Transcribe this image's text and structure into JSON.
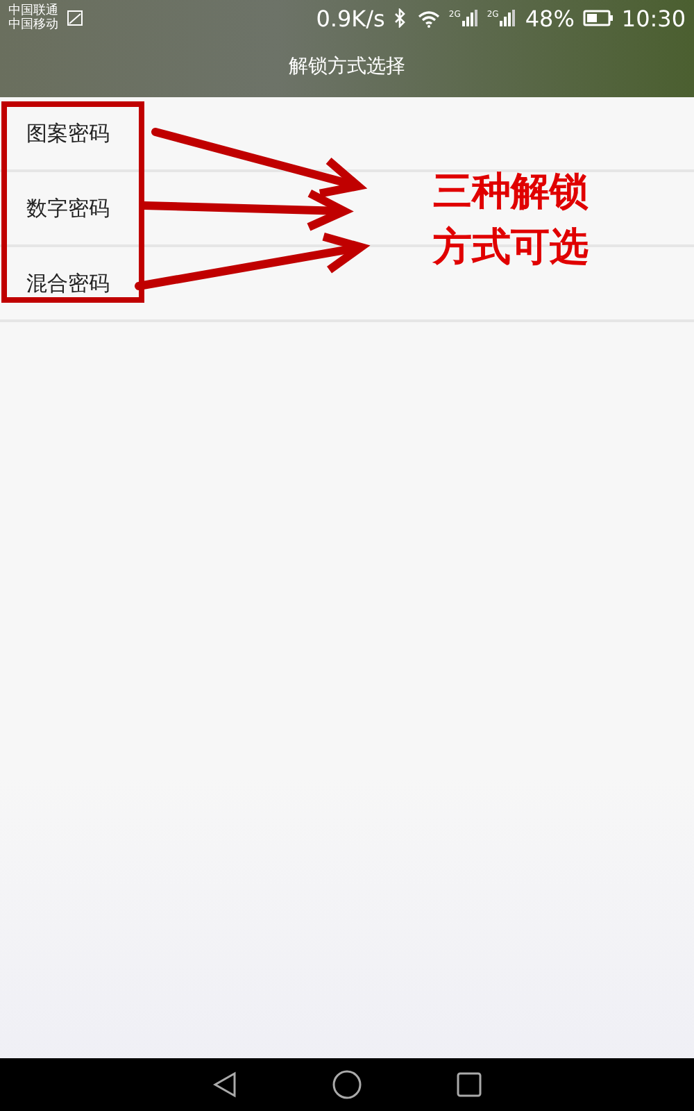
{
  "status_bar": {
    "carriers": [
      "中国联通",
      "中国移动"
    ],
    "speed": "0.9K/s",
    "sim_signals": [
      "2G",
      "2G"
    ],
    "battery": "48%",
    "time": "10:30"
  },
  "title": "解锁方式选择",
  "options": [
    {
      "label": "图案密码"
    },
    {
      "label": "数字密码"
    },
    {
      "label": "混合密码"
    }
  ],
  "annotation": {
    "lines": [
      "三种解锁",
      "方式可选"
    ]
  }
}
